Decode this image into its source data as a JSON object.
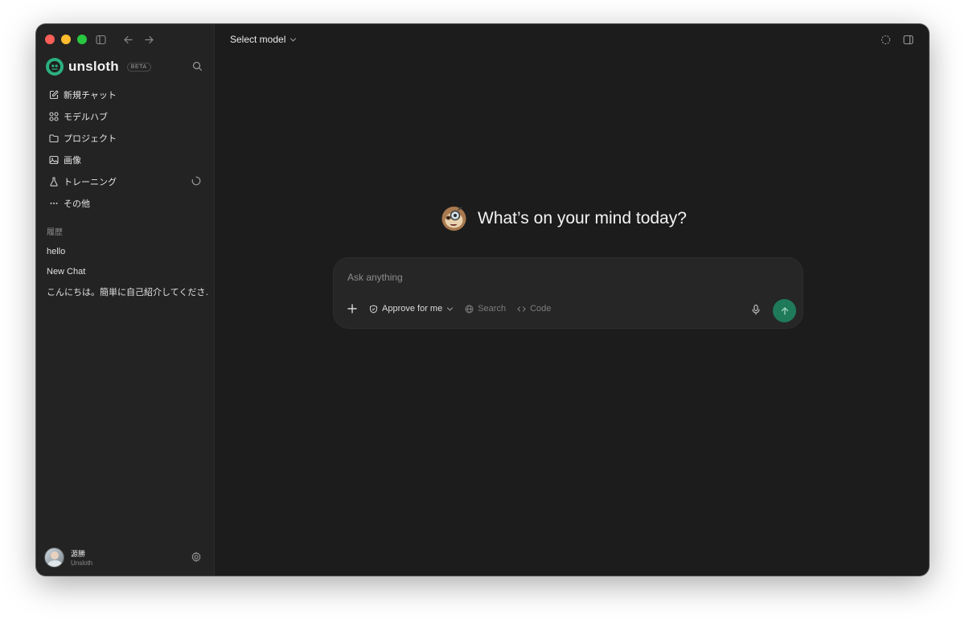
{
  "window_controls": [
    "close",
    "minimize",
    "maximize"
  ],
  "sidebar": {
    "brand": {
      "name": "unsloth",
      "badge": "BETA"
    },
    "nav_items": [
      {
        "label": "新規チャット",
        "icon": "edit-icon"
      },
      {
        "label": "モデルハブ",
        "icon": "hub-icon"
      },
      {
        "label": "プロジェクト",
        "icon": "folder-icon"
      },
      {
        "label": "画像",
        "icon": "image-icon"
      },
      {
        "label": "トレーニング",
        "icon": "flask-icon"
      },
      {
        "label": "その他",
        "icon": "more-icon"
      }
    ],
    "history_label": "履歴",
    "history": [
      "hello",
      "New Chat",
      "こんにちは。簡単に自己紹介してくださ…"
    ],
    "user": {
      "name": "源勝",
      "org": "Unsloth"
    }
  },
  "header": {
    "model_select": "Select model"
  },
  "main": {
    "greeting": "What’s on your mind today?",
    "composer": {
      "placeholder": "Ask anything",
      "approve_label": "Approve for me",
      "search_label": "Search",
      "code_label": "Code"
    }
  },
  "colors": {
    "accent": "#1f7a5a",
    "brand": "#2bb07f",
    "bg": "#1c1c1c",
    "sidebar": "#232323"
  }
}
